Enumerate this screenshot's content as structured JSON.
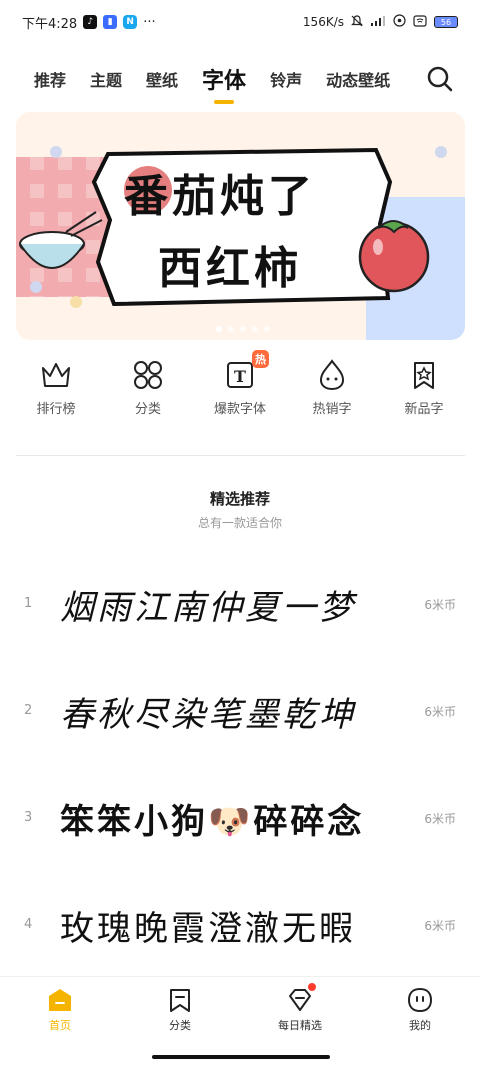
{
  "status_bar": {
    "time": "下午4:28",
    "more": "···",
    "network_speed": "156K/s",
    "battery": "56"
  },
  "top_nav": {
    "tabs": [
      {
        "label": "推荐"
      },
      {
        "label": "主题"
      },
      {
        "label": "壁纸"
      },
      {
        "label": "字体"
      },
      {
        "label": "铃声"
      },
      {
        "label": "动态壁纸"
      }
    ],
    "active": "字体"
  },
  "banner": {
    "line1": "番茄炖了",
    "line2": "西红柿",
    "page_count": 5,
    "current_page": 1
  },
  "categories": [
    {
      "label": "排行榜",
      "icon": "crown-icon"
    },
    {
      "label": "分类",
      "icon": "grid-icon"
    },
    {
      "label": "爆款字体",
      "icon": "font-t-icon",
      "badge": "热"
    },
    {
      "label": "热销字",
      "icon": "flame-icon"
    },
    {
      "label": "新品字",
      "icon": "star-tag-icon"
    }
  ],
  "section": {
    "title": "精选推荐",
    "subtitle": "总有一款适合你"
  },
  "fonts": [
    {
      "rank": "1",
      "sample": "烟雨江南仲夏一梦",
      "price": "6米币"
    },
    {
      "rank": "2",
      "sample": "春秋尽染笔墨乾坤",
      "price": "6米币"
    },
    {
      "rank": "3",
      "sample": "笨笨小狗🐶碎碎念",
      "price": "6米币"
    },
    {
      "rank": "4",
      "sample": "玫瑰晚霞澄澈无暇",
      "price": "6米币"
    }
  ],
  "bottom_nav": {
    "items": [
      {
        "label": "首页",
        "icon": "home-icon"
      },
      {
        "label": "分类",
        "icon": "bookmark-icon"
      },
      {
        "label": "每日精选",
        "icon": "diamond-icon"
      },
      {
        "label": "我的",
        "icon": "smiley-icon"
      }
    ]
  },
  "colors": {
    "accent": "#f5b400",
    "badge": "#ff6a3d",
    "notification": "#ff3b30"
  }
}
